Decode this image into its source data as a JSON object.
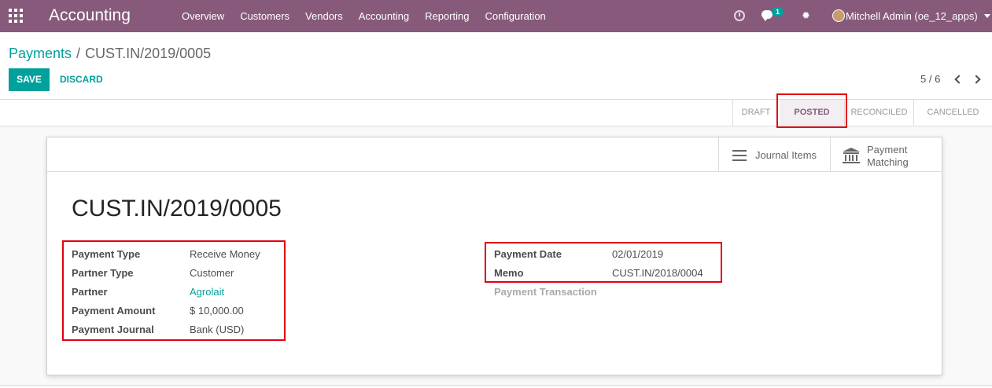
{
  "navbar": {
    "app_title": "Accounting",
    "menu": [
      "Overview",
      "Customers",
      "Vendors",
      "Accounting",
      "Reporting",
      "Configuration"
    ],
    "chat_count": "1",
    "user": "Mitchell Admin (oe_12_apps)",
    "bg_color": "#875a7b"
  },
  "breadcrumb": {
    "parent": "Payments",
    "separator": "/",
    "current": "CUST.IN/2019/0005"
  },
  "actions": {
    "save": "SAVE",
    "discard": "DISCARD"
  },
  "pager": {
    "text": "5 / 6"
  },
  "statusbar": {
    "stages": [
      "DRAFT",
      "POSTED",
      "RECONCILED",
      "CANCELLED"
    ],
    "active": "POSTED"
  },
  "smart_buttons": {
    "journal_items": "Journal Items",
    "payment_matching_line1": "Payment",
    "payment_matching_line2": "Matching"
  },
  "record": {
    "title": "CUST.IN/2019/0005",
    "left_fields": [
      {
        "label": "Payment Type",
        "value": "Receive Money"
      },
      {
        "label": "Partner Type",
        "value": "Customer"
      },
      {
        "label": "Partner",
        "value": "Agrolait"
      },
      {
        "label": "Payment Amount",
        "value": "$ 10,000.00"
      },
      {
        "label": "Payment Journal",
        "value": "Bank (USD)"
      }
    ],
    "right_fields": [
      {
        "label": "Payment Date",
        "value": "02/01/2019"
      },
      {
        "label": "Memo",
        "value": "CUST.IN/2018/0004"
      },
      {
        "label": "Payment Transaction",
        "value": ""
      }
    ]
  },
  "colors": {
    "accent": "#00a09d",
    "highlight": "#e3000f",
    "brand": "#875a7b"
  }
}
